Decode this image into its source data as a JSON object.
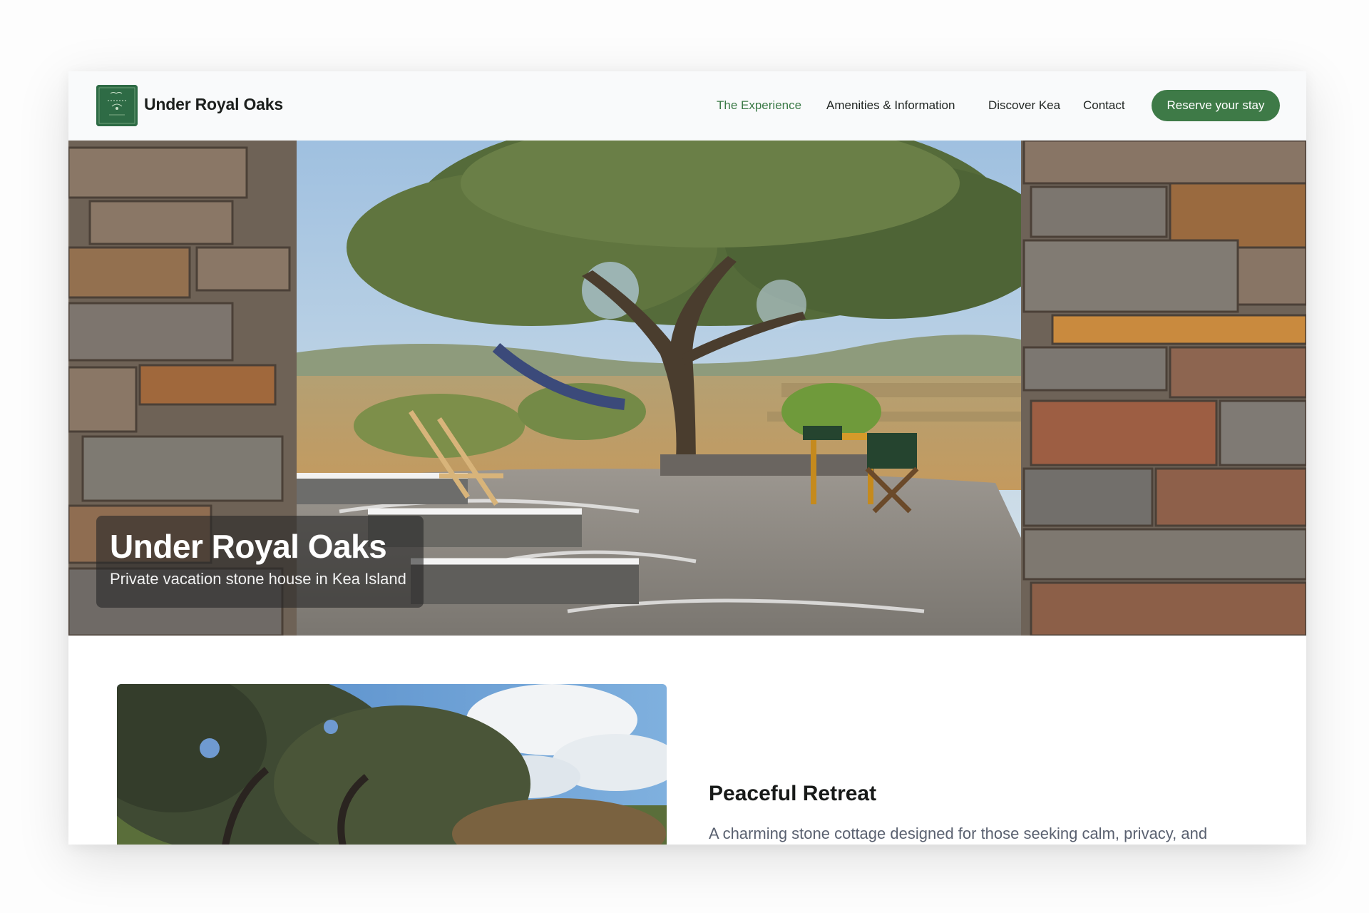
{
  "header": {
    "brand": "Under Royal Oaks",
    "nav": [
      {
        "label": "The Experience",
        "active": true
      },
      {
        "label": "Amenities & Information",
        "active": false
      },
      {
        "label": "Discover Kea",
        "active": false
      },
      {
        "label": "Contact",
        "active": false
      }
    ],
    "cta": "Reserve your stay"
  },
  "hero": {
    "title": "Under Royal Oaks",
    "subtitle": "Private vacation stone house in Kea Island"
  },
  "feature": {
    "title": "Peaceful Retreat",
    "text": "A charming stone cottage designed for those seeking calm, privacy, and"
  },
  "colors": {
    "accent": "#3e7a47",
    "nav_active": "#3b7a47",
    "logo_bg": "#2e6b45",
    "header_bg": "#f9fafb"
  }
}
